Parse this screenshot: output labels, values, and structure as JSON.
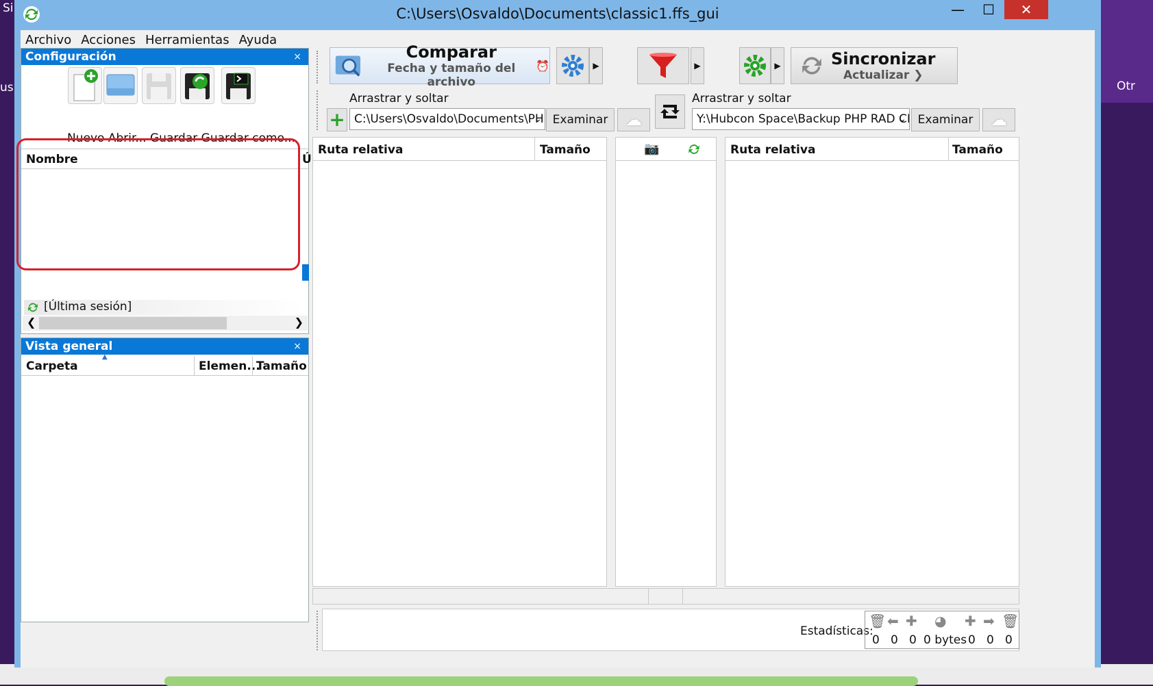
{
  "window": {
    "title": "C:\\Users\\Osvaldo\\Documents\\classic1.ffs_gui",
    "minimize": "—",
    "maximize": "☐",
    "close": "✕"
  },
  "background": {
    "left_text": "Si",
    "left_text2": "us",
    "right_text": "Otr"
  },
  "menu": [
    "Archivo",
    "Acciones",
    "Herramientas",
    "Ayuda"
  ],
  "config_panel": {
    "title": "Configuración",
    "close": "×",
    "toolbar_labels": "Nuevo Abrir... Guardar Guardar como...",
    "column_name": "Nombre",
    "column_last": "Ú",
    "last_session": "[Última sesión]"
  },
  "overview_panel": {
    "title": "Vista general",
    "close": "×",
    "columns": [
      "Carpeta",
      "Elemen...",
      "Tamaño"
    ]
  },
  "compare": {
    "title": "Comparar",
    "subtitle": "Fecha y tamaño del archivo"
  },
  "sync": {
    "title": "Sincronizar",
    "subtitle": "Actualizar ❯"
  },
  "left_folder": {
    "drag_label": "Arrastrar y soltar",
    "path": "C:\\Users\\Osvaldo\\Documents\\PHP",
    "browse": "Examinar"
  },
  "right_folder": {
    "drag_label": "Arrastrar y soltar",
    "path": "Y:\\Hubcon Space\\Backup PHP RAD CLA",
    "browse": "Examinar"
  },
  "grid": {
    "left_cols": [
      "Ruta relativa",
      "Tamaño"
    ],
    "right_cols": [
      "Ruta relativa",
      "Tamaño"
    ]
  },
  "stats": {
    "label": "Estadísticas:",
    "values": [
      "0",
      "0",
      "0",
      "0 bytes",
      "0",
      "0",
      "0"
    ]
  },
  "colors": {
    "accent": "#0a78d7",
    "frame": "#7fb6e8",
    "highlight": "#d6202b"
  }
}
